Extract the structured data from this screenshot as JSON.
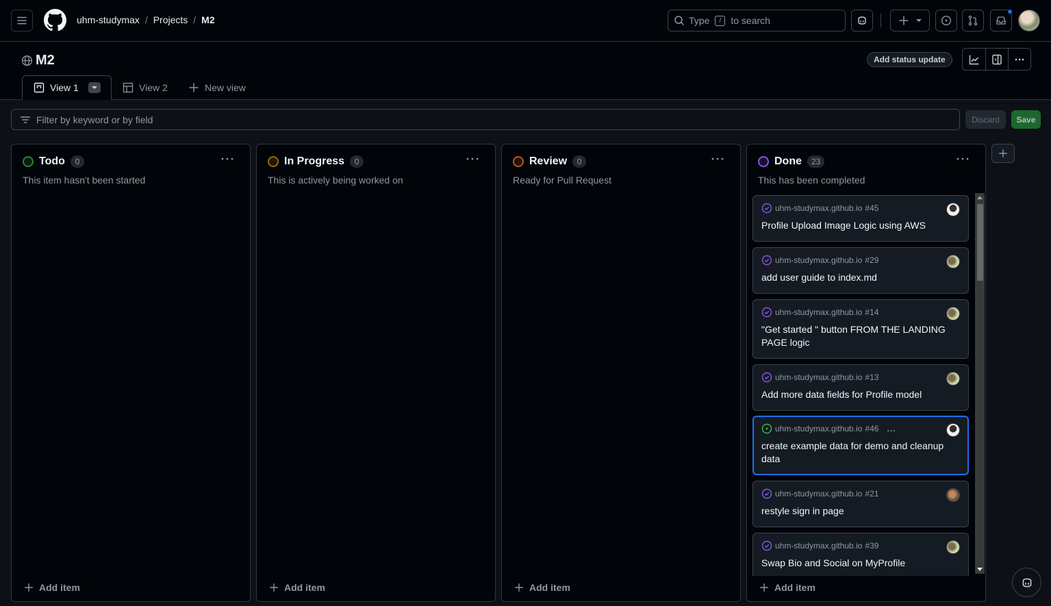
{
  "header": {
    "breadcrumb": [
      "uhm-studymax",
      "Projects",
      "M2"
    ],
    "breadcrumb_separator": "/",
    "search": {
      "prefix": "Type",
      "key": "/",
      "suffix": "to search"
    },
    "icons": [
      "hamburger-icon",
      "github-logo",
      "copilot-icon",
      "plus-icon",
      "issues-icon",
      "pull-requests-icon",
      "inbox-icon",
      "avatar"
    ],
    "notification_indicator_color": "#1f6feb"
  },
  "project": {
    "title": "M2",
    "visibility_icon": "globe-icon",
    "status_button": "Add status update",
    "toolbar_icons": [
      "insights-icon",
      "side-panel-icon",
      "more-icon"
    ]
  },
  "tabs": [
    {
      "label": "View 1",
      "icon": "board-icon",
      "active": true
    },
    {
      "label": "View 2",
      "icon": "table-icon",
      "active": false
    },
    {
      "label": "New view",
      "icon": "plus-icon",
      "active": false
    }
  ],
  "filter": {
    "placeholder": "Filter by keyword or by field",
    "value": ""
  },
  "actions": {
    "discard": "Discard",
    "save": "Save"
  },
  "columns": [
    {
      "name": "Todo",
      "count": "0",
      "description": "This item hasn't been started",
      "color": "#238636",
      "fill": "#0b1f12",
      "add_label": "Add item"
    },
    {
      "name": "In Progress",
      "count": "0",
      "description": "This is actively being worked on",
      "color": "#9e6a03",
      "fill": "#201700",
      "add_label": "Add item"
    },
    {
      "name": "Review",
      "count": "0",
      "description": "Ready for Pull Request",
      "color": "#bd561d",
      "fill": "#22120a",
      "add_label": "Add item"
    },
    {
      "name": "Done",
      "count": "23",
      "description": "This has been completed",
      "color": "#8957e5",
      "fill": "#1a1030",
      "add_label": "Add item",
      "cards": [
        {
          "repo": "uhm-studymax.github.io",
          "number": "#45",
          "title": "Profile Upload Image Logic using AWS",
          "state": "closed",
          "avatar": "av1"
        },
        {
          "repo": "uhm-studymax.github.io",
          "number": "#29",
          "title": "add user guide to index.md",
          "state": "closed",
          "avatar": "av2"
        },
        {
          "repo": "uhm-studymax.github.io",
          "number": "#14",
          "title": "\"Get started \" button FROM THE LANDING PAGE logic",
          "state": "closed",
          "avatar": "av2"
        },
        {
          "repo": "uhm-studymax.github.io",
          "number": "#13",
          "title": "Add more data fields for Profile model",
          "state": "closed",
          "avatar": "av2"
        },
        {
          "repo": "uhm-studymax.github.io",
          "number": "#46",
          "title": "create example data for demo and cleanup data",
          "state": "open",
          "avatar": "av1",
          "selected": true,
          "menu": "..."
        },
        {
          "repo": "uhm-studymax.github.io",
          "number": "#21",
          "title": "restyle sign in page",
          "state": "closed",
          "avatar": "av3"
        },
        {
          "repo": "uhm-studymax.github.io",
          "number": "#39",
          "title": "Swap Bio and Social on MyProfile",
          "state": "closed",
          "avatar": "av2"
        }
      ]
    }
  ],
  "colors": {
    "closed_purple": "#8957e5",
    "open_green": "#3fb950",
    "selected_border": "#1f6feb",
    "save_green": "#238636"
  }
}
